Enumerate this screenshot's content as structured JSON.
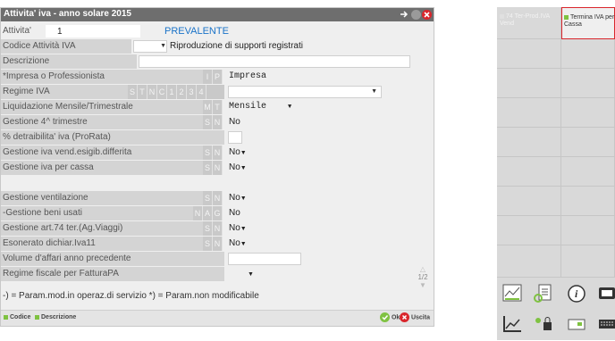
{
  "dialog": {
    "title": "Attivita' iva - anno solare 2015",
    "attivita_label": "Attivita'",
    "attivita_value": "1",
    "prevalente": "PREVALENTE",
    "codice_label": "Codice Attività IVA",
    "codice_desc": "Riproduzione di supporti registrati",
    "descrizione_label": "Descrizione",
    "impresa_label": "*Impresa o Professionista",
    "impresa_flags": [
      "I",
      "P"
    ],
    "impresa_value": "Impresa",
    "regime_label": "Regime IVA",
    "regime_flags": [
      "S",
      "T",
      "N",
      "C",
      "1",
      "2",
      "3",
      "4"
    ],
    "liquidazione_label": "Liquidazione Mensile/Trimestrale",
    "liquidazione_flags": [
      "M",
      "T"
    ],
    "liquidazione_value": "Mensile",
    "gestione4_label": "Gestione 4^ trimestre",
    "sn_flags": [
      "S",
      "N"
    ],
    "gestione4_value": "No",
    "prorata_label": "% detraibilita' iva (ProRata)",
    "esigib_label": "Gestione iva vend.esigib.differita",
    "esigib_value": "No",
    "cassa_label": "Gestione iva per cassa",
    "cassa_value": "No",
    "ventilazione_label": "Gestione ventilazione",
    "ventilazione_value": "No",
    "usati_label": "-Gestione beni usati",
    "usati_flags": [
      "N",
      "A",
      "G"
    ],
    "usati_value": "No",
    "art74_label": "Gestione art.74 ter.(Ag.Viaggi)",
    "art74_value": "No",
    "esonerato_label": "Esonerato dichiar.Iva11",
    "esonerato_value": "No",
    "volume_label": "Volume d'affari anno precedente",
    "regime_fpa_label": "Regime fiscale per FatturaPA",
    "page_indicator": "1/2",
    "footer_note": "-) = Param.mod.in operaz.di servizio   *) = Param.non modificabile",
    "fkeys": {
      "codice": "Codice",
      "descrizione": "Descrizione",
      "ok": "Ok",
      "uscita": "Uscita"
    }
  },
  "panel": {
    "btn1": "74 Ter-Prod.IVA Vend",
    "btn2": "Termina IVA per Cassa"
  },
  "colors": {
    "accent": "#1a73c8",
    "ok": "#7fc241",
    "close": "#d9262c",
    "key": "#7fc241"
  }
}
